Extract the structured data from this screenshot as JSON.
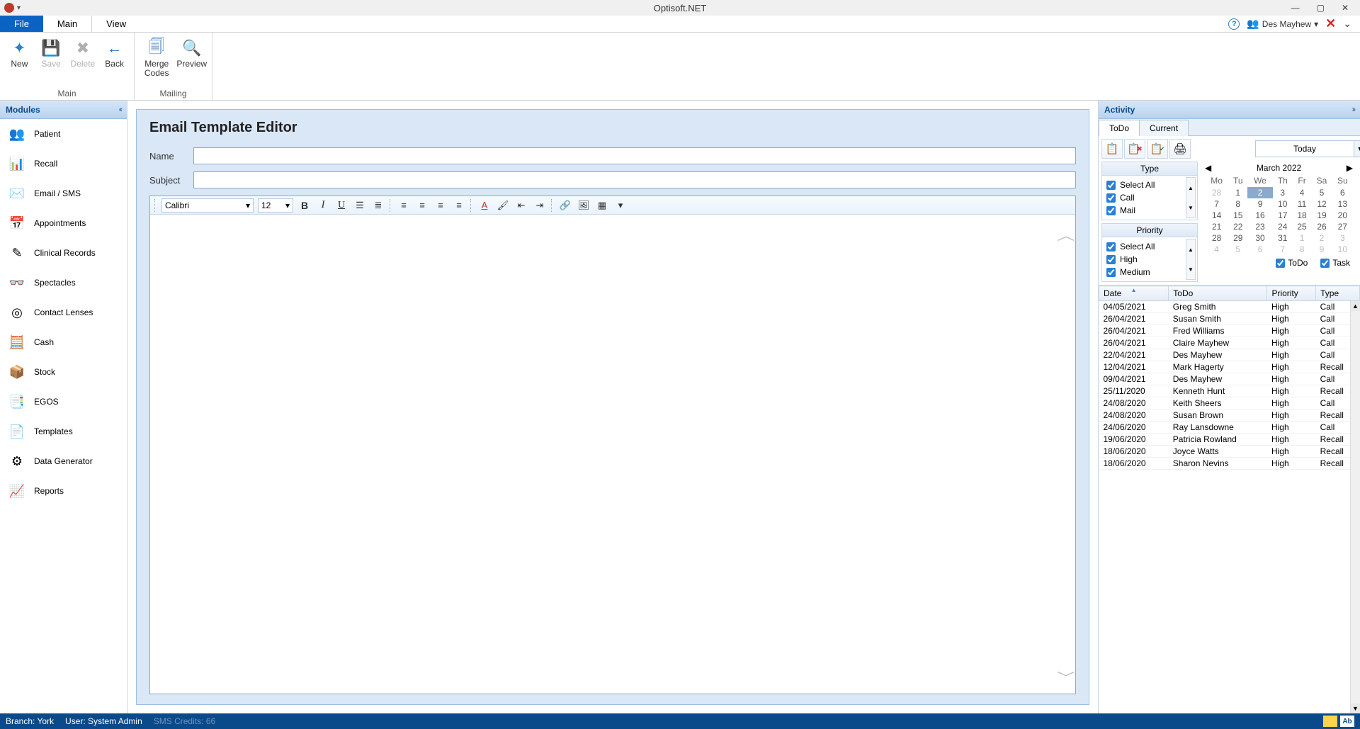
{
  "app": {
    "title": "Optisoft.NET",
    "user": "Des Mayhew"
  },
  "menuTabs": {
    "file": "File",
    "main": "Main",
    "view": "View"
  },
  "ribbon": {
    "main": {
      "label": "Main",
      "new": "New",
      "save": "Save",
      "delete": "Delete",
      "back": "Back"
    },
    "mailing": {
      "label": "Mailing",
      "merge": "Merge\nCodes",
      "preview": "Preview"
    }
  },
  "modules": {
    "title": "Modules",
    "items": [
      {
        "label": "Patient"
      },
      {
        "label": "Recall"
      },
      {
        "label": "Email / SMS"
      },
      {
        "label": "Appointments"
      },
      {
        "label": "Clinical Records"
      },
      {
        "label": "Spectacles"
      },
      {
        "label": "Contact Lenses"
      },
      {
        "label": "Cash"
      },
      {
        "label": "Stock"
      },
      {
        "label": "EGOS"
      },
      {
        "label": "Templates"
      },
      {
        "label": "Data Generator"
      },
      {
        "label": "Reports"
      }
    ]
  },
  "editor": {
    "heading": "Email Template Editor",
    "nameLabel": "Name",
    "nameValue": "",
    "subjectLabel": "Subject",
    "subjectValue": "",
    "font": "Calibri",
    "size": "12"
  },
  "activity": {
    "title": "Activity",
    "tabs": {
      "todo": "ToDo",
      "current": "Current"
    },
    "todayBtn": "Today",
    "typeHeader": "Type",
    "typeOptions": [
      "Select All",
      "Call",
      "Mail"
    ],
    "priorityHeader": "Priority",
    "priorityOptions": [
      "Select All",
      "High",
      "Medium"
    ],
    "chkTodo": "ToDo",
    "chkTask": "Task",
    "calendar": {
      "month": "March 2022",
      "dow": [
        "Mo",
        "Tu",
        "We",
        "Th",
        "Fr",
        "Sa",
        "Su"
      ],
      "weeks": [
        [
          {
            "d": 28,
            "dim": true
          },
          {
            "d": 1
          },
          {
            "d": 2,
            "sel": true
          },
          {
            "d": 3
          },
          {
            "d": 4
          },
          {
            "d": 5
          },
          {
            "d": 6
          }
        ],
        [
          {
            "d": 7
          },
          {
            "d": 8
          },
          {
            "d": 9
          },
          {
            "d": 10
          },
          {
            "d": 11
          },
          {
            "d": 12
          },
          {
            "d": 13
          }
        ],
        [
          {
            "d": 14
          },
          {
            "d": 15
          },
          {
            "d": 16
          },
          {
            "d": 17
          },
          {
            "d": 18
          },
          {
            "d": 19
          },
          {
            "d": 20
          }
        ],
        [
          {
            "d": 21
          },
          {
            "d": 22
          },
          {
            "d": 23
          },
          {
            "d": 24
          },
          {
            "d": 25
          },
          {
            "d": 26
          },
          {
            "d": 27
          }
        ],
        [
          {
            "d": 28
          },
          {
            "d": 29
          },
          {
            "d": 30
          },
          {
            "d": 31
          },
          {
            "d": 1,
            "dim": true
          },
          {
            "d": 2,
            "dim": true
          },
          {
            "d": 3,
            "dim": true
          }
        ],
        [
          {
            "d": 4,
            "dim": true
          },
          {
            "d": 5,
            "dim": true
          },
          {
            "d": 6,
            "dim": true
          },
          {
            "d": 7,
            "dim": true
          },
          {
            "d": 8,
            "dim": true
          },
          {
            "d": 9,
            "dim": true
          },
          {
            "d": 10,
            "dim": true
          }
        ]
      ]
    },
    "grid": {
      "cols": [
        "Date",
        "ToDo",
        "Priority",
        "Type"
      ],
      "rows": [
        [
          "04/05/2021",
          "Greg Smith",
          "High",
          "Call"
        ],
        [
          "26/04/2021",
          "Susan Smith",
          "High",
          "Call"
        ],
        [
          "26/04/2021",
          "Fred Williams",
          "High",
          "Call"
        ],
        [
          "26/04/2021",
          "Claire Mayhew",
          "High",
          "Call"
        ],
        [
          "22/04/2021",
          "Des Mayhew",
          "High",
          "Call"
        ],
        [
          "12/04/2021",
          "Mark Hagerty",
          "High",
          "Recall"
        ],
        [
          "09/04/2021",
          "Des Mayhew",
          "High",
          "Call"
        ],
        [
          "25/11/2020",
          "Kenneth Hunt",
          "High",
          "Recall"
        ],
        [
          "24/08/2020",
          "Keith Sheers",
          "High",
          "Call"
        ],
        [
          "24/08/2020",
          "Susan Brown",
          "High",
          "Recall"
        ],
        [
          "24/06/2020",
          "Ray Lansdowne",
          "High",
          "Call"
        ],
        [
          "19/06/2020",
          "Patricia Rowland",
          "High",
          "Recall"
        ],
        [
          "18/06/2020",
          "Joyce Watts",
          "High",
          "Recall"
        ],
        [
          "18/06/2020",
          "Sharon Nevins",
          "High",
          "Recall"
        ]
      ]
    }
  },
  "status": {
    "branch": "Branch: York",
    "user": "User: System Admin",
    "sms": "SMS Credits: 66",
    "ab": "Ab"
  }
}
